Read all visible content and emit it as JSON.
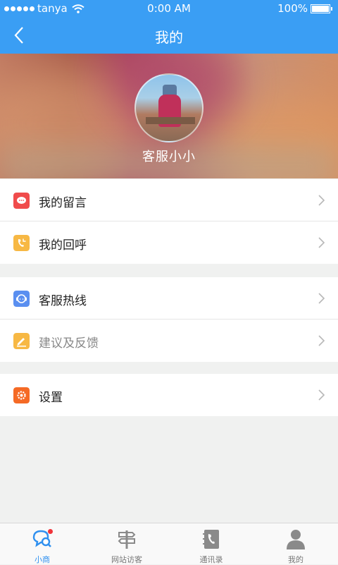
{
  "status_bar": {
    "carrier": "tanya",
    "time": "0:00 AM",
    "battery": "100%"
  },
  "nav": {
    "title": "我的",
    "back_icon": "chevron-left-icon"
  },
  "profile": {
    "name": "客服小小"
  },
  "menu_groups": [
    [
      {
        "label": "我的留言",
        "icon": "message-icon",
        "icon_color": "#f04b4b"
      },
      {
        "label": "我的回呼",
        "icon": "callback-icon",
        "icon_color": "#f7b844"
      }
    ],
    [
      {
        "label": "客服热线",
        "icon": "hotline-icon",
        "icon_color": "#5a8ff0"
      },
      {
        "label": "建议及反馈",
        "icon": "feedback-icon",
        "icon_color": "#f7b844"
      }
    ],
    [
      {
        "label": "设置",
        "icon": "settings-icon",
        "icon_color": "#f56a25"
      }
    ]
  ],
  "tabs": [
    {
      "label": "小商",
      "icon": "chat-search-icon",
      "active": true
    },
    {
      "label": "网站访客",
      "icon": "signpost-icon",
      "active": false
    },
    {
      "label": "通讯录",
      "icon": "contacts-book-icon",
      "active": false
    },
    {
      "label": "我的",
      "icon": "person-icon",
      "active": false
    }
  ],
  "colors": {
    "primary": "#3a9ef4",
    "tab_active": "#2f90ef",
    "tab_inactive": "#888888"
  }
}
